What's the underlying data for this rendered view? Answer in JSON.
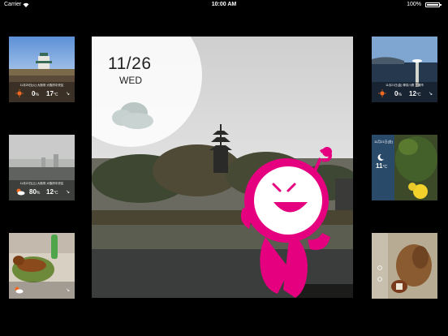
{
  "status_bar": {
    "carrier": "Carrier",
    "time": "10:00 AM",
    "battery": "100%"
  },
  "main_card": {
    "date": "11/26",
    "weekday": "WED",
    "icon": "cloud-icon",
    "character": "pink-mascot"
  },
  "left_thumbs": [
    {
      "caption": "11月25日(火) 大阪府 大阪府中央区",
      "icon": "sun-icon",
      "precip": "0",
      "temp": "17",
      "wind_icon": "wind-icon"
    },
    {
      "caption": "11月22日(土) 大阪府 大阪府中央区",
      "icon": "sun-cloud-icon",
      "precip": "80",
      "temp": "12",
      "wind_icon": "wind-icon"
    },
    {
      "caption": "",
      "icon": "sun-cloud-icon",
      "precip": "",
      "temp": "",
      "wind_icon": "wind-icon"
    }
  ],
  "right_thumbs": [
    {
      "caption": "11月21日(金) 神奈川県 三浦市",
      "icon": "sun-icon",
      "precip": "0",
      "temp": "12",
      "wind_icon": "wind-icon"
    },
    {
      "caption": "11月21日(金)",
      "icon": "moon-icon",
      "precip": "",
      "temp": "11",
      "wind_icon": ""
    },
    {
      "caption": "",
      "icon": "",
      "precip": "",
      "temp": "",
      "wind_icon": ""
    }
  ],
  "units": {
    "percent": "%",
    "celsius": "°C"
  },
  "colors": {
    "accent": "#e6007e",
    "sun": "#f26a21",
    "background": "#000000"
  }
}
